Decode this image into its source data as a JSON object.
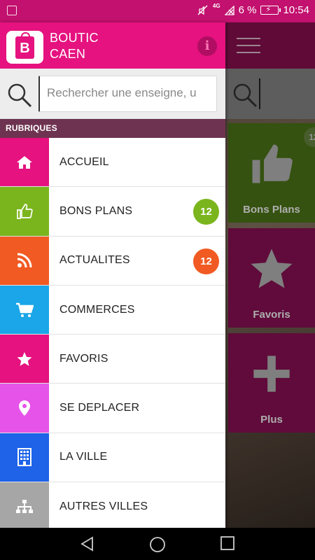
{
  "status_bar": {
    "network": "4G",
    "battery": "6 %",
    "time": "10:54"
  },
  "header": {
    "title_line1": "BOUTIC",
    "title_line2": "CAEN"
  },
  "search": {
    "placeholder": "Rechercher une enseigne, u"
  },
  "drawer": {
    "section_title": "RUBRIQUES",
    "items": [
      {
        "label": "ACCUEIL",
        "icon": "home-icon",
        "color": "#e5127f"
      },
      {
        "label": "BONS PLANS",
        "icon": "thumbs-up-icon",
        "color": "#7ab51d",
        "badge": "12",
        "badge_color": "#7ab51d"
      },
      {
        "label": "ACTUALITES",
        "icon": "rss-icon",
        "color": "#f15a22",
        "badge": "12",
        "badge_color": "#f15a22"
      },
      {
        "label": "COMMERCES",
        "icon": "cart-icon",
        "color": "#1aa6e8"
      },
      {
        "label": "FAVORIS",
        "icon": "star-icon",
        "color": "#e5127f"
      },
      {
        "label": "SE DEPLACER",
        "icon": "map-pin-icon",
        "color": "#e653e8"
      },
      {
        "label": "LA VILLE",
        "icon": "building-icon",
        "color": "#1e63e8"
      },
      {
        "label": "AUTRES VILLES",
        "icon": "sitemap-icon",
        "color": "#a6a6a6"
      }
    ]
  },
  "background_tiles": [
    {
      "label": "Bons Plans",
      "icon": "thumbs-up-icon",
      "badge": "12"
    },
    {
      "label": "Favoris",
      "icon": "star-icon"
    },
    {
      "label": "Plus",
      "icon": "plus-icon"
    }
  ]
}
